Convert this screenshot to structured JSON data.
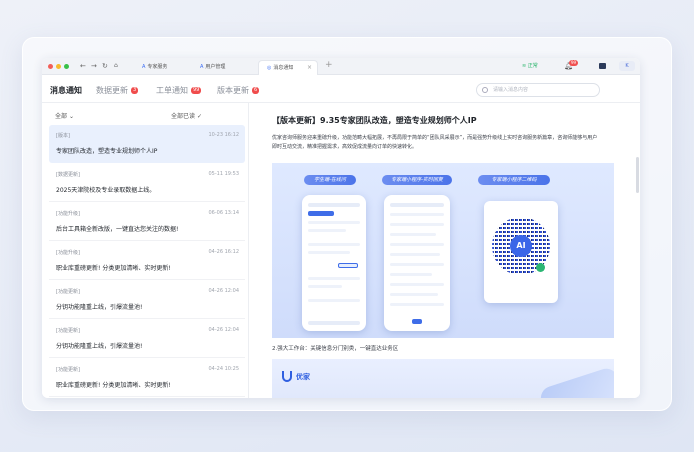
{
  "browser": {
    "tabs": [
      {
        "label": "专家服务",
        "active": false
      },
      {
        "label": "用户管理",
        "active": false
      },
      {
        "label": "消息通知",
        "active": true
      }
    ],
    "status": "正常",
    "notification_count": "99",
    "user_initial": "K"
  },
  "header": {
    "tabs": [
      {
        "label": "消息通知",
        "badge": ""
      },
      {
        "label": "数据更新",
        "badge": "3"
      },
      {
        "label": "工单通知",
        "badge": "99"
      },
      {
        "label": "版本更新",
        "badge": "6"
      }
    ],
    "search_placeholder": "请输入消息内容"
  },
  "list": {
    "filter_all": "全部",
    "filter_read": "全部已读",
    "items": [
      {
        "category": "[版本]",
        "time": "10-23 16:12",
        "title": "专家团队改造，塑造专业规划师个人IP"
      },
      {
        "category": "[数据更新]",
        "time": "05-11 19:53",
        "title": "2025天津院校及专业录取数据上线。"
      },
      {
        "category": "[功能升级]",
        "time": "06-06 13:14",
        "title": "后台工具箱全新改版，一键直达您关注的数据!"
      },
      {
        "category": "[功能升级]",
        "time": "04-26 16:12",
        "title": "职业库重磅更新! 分类更加清晰、实时更新!"
      },
      {
        "category": "[功能更新]",
        "time": "04-26 12:04",
        "title": "分钥功能隆重上线，引爆流量池!"
      },
      {
        "category": "[功能更新]",
        "time": "04-26 12:04",
        "title": "分钥功能隆重上线，引爆流量池!"
      },
      {
        "category": "[功能更新]",
        "time": "04-24 10:25",
        "title": "职业库重磅更新! 分类更加清晰、实时更新!"
      }
    ]
  },
  "article": {
    "title": "【版本更新】9.35专家团队改造，塑造专业规划师个人IP",
    "body": "优家咨询师服务迎来重磅升级，功能范畴大幅拓展，不再局限于简单的“团队风采展示”，而是强势升级线上实时咨询服务新篇章，咨询师能够与用户即时互动交流，精准把握需求，高效促成流量向订单的快速转化。",
    "hero_labels": [
      "学生端-在线问",
      "专家端小程序-实时回复",
      "专家端小程序二维码"
    ],
    "qr_text": "AI",
    "caption": "2.强大工作台：关键信息分门别类，一键直达业务区",
    "banner_name": "优家"
  }
}
